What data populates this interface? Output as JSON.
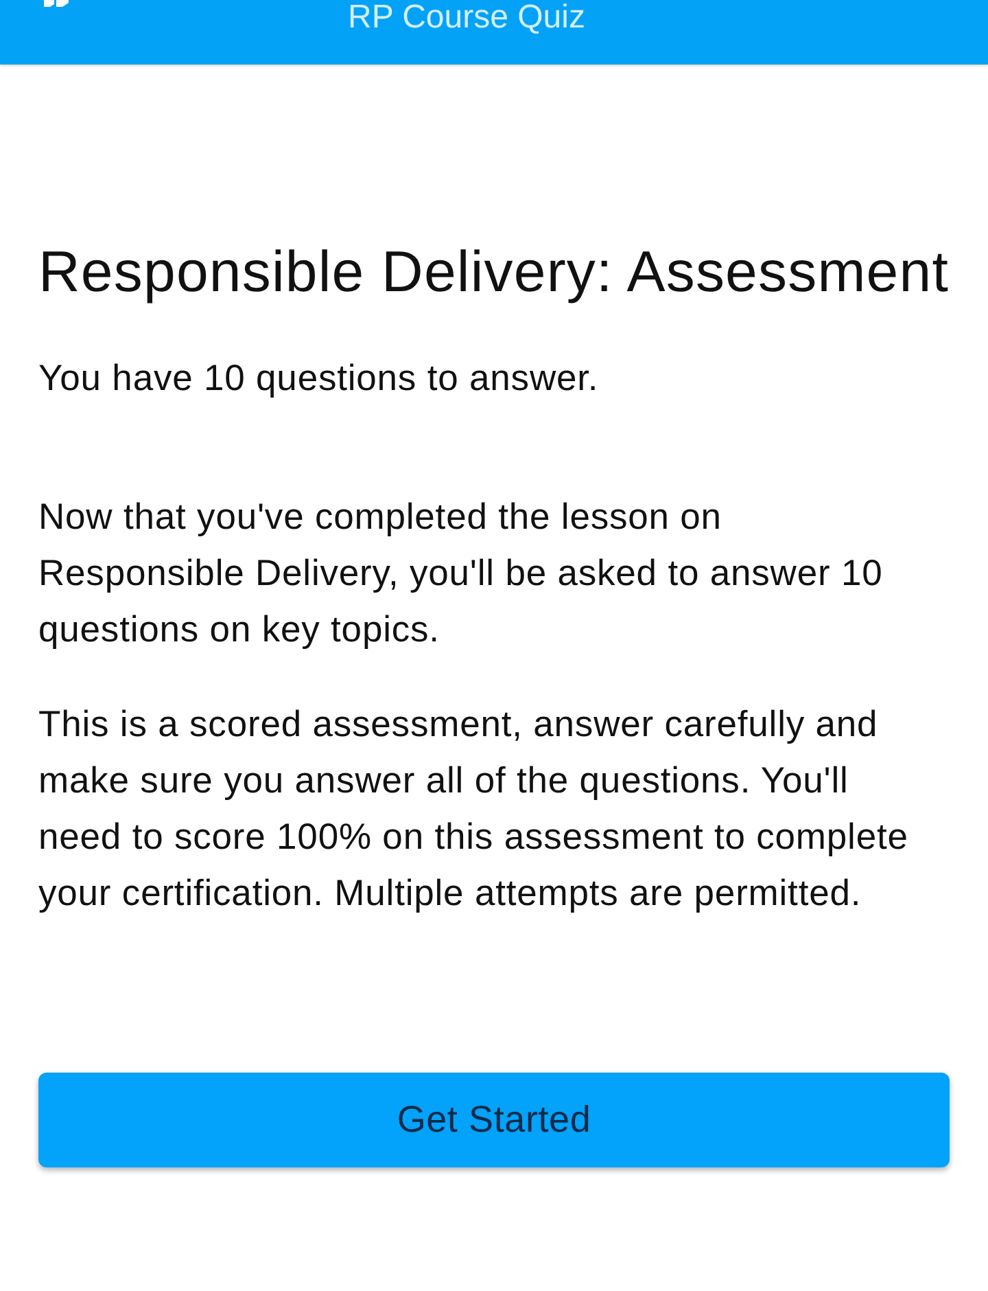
{
  "header": {
    "title": "RP Course Quiz"
  },
  "heading": "Responsible Delivery: Assessment",
  "intro": "You have 10 questions to answer.",
  "paragraphs": [
    "Now that you've completed the lesson on Responsible Delivery, you'll be asked to answer 10 questions on key topics.",
    "This is a scored assessment, answer carefully and make sure you answer all of the questions. You'll need to score 100% on this assessment to complete your certification. Multiple attempts are permitted."
  ],
  "button": {
    "label": "Get Started"
  }
}
